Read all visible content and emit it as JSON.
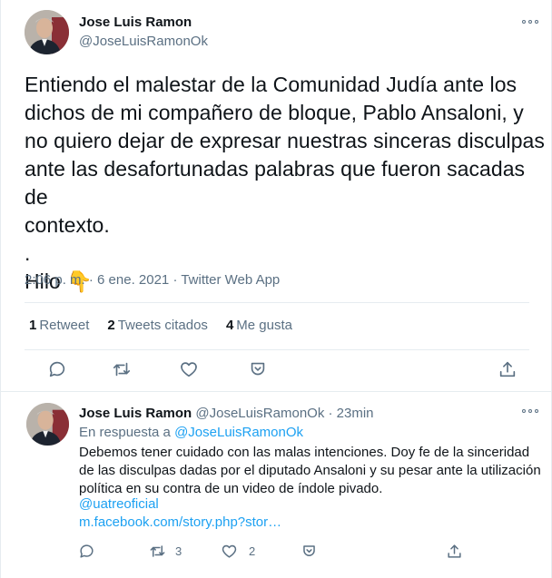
{
  "main_tweet": {
    "author_name": "Jose Luis Ramon",
    "handle": "@JoseLuisRamonOk",
    "text": "Entiendo el malestar de la Comunidad Judía ante los\ndichos de mi compañero de bloque, Pablo Ansaloni, y\nno quiero dejar de expresar nuestras sinceras disculpas\nante las desafortunadas palabras que fueron sacadas de\ncontexto.\n.\nHilo 👇",
    "meta": "2:06 p. m. · 6 ene. 2021 · Twitter Web App",
    "stats": [
      {
        "count": "1",
        "label": "Retweet"
      },
      {
        "count": "2",
        "label": "Tweets citados"
      },
      {
        "count": "4",
        "label": "Me gusta"
      }
    ]
  },
  "reply_tweet": {
    "author_name": "Jose Luis Ramon",
    "handle": "@JoseLuisRamonOk",
    "separator": "·",
    "time": "23min",
    "reply_prefix": "En respuesta a",
    "reply_to": "@JoseLuisRamonOk",
    "text": "Debemos tener cuidado con las malas intenciones. Doy fe de la sinceridad de las disculpas dadas por el diputado Ansaloni y su pesar ante la utilización política en su contra de un video de índole pivado.",
    "mention": "@uatreoficial",
    "url": "m.facebook.com/story.php?stor…",
    "retweet_count": "3",
    "like_count": "2"
  },
  "icons": {
    "more": "more-horizontal-icon",
    "reply": "reply-icon",
    "retweet": "retweet-icon",
    "like": "like-icon",
    "bookmark": "bookmark-icon",
    "share": "share-icon"
  },
  "colors": {
    "text": "#0f1419",
    "secondary": "#5b7083",
    "link": "#1da1f2",
    "border": "#e6ecf0"
  }
}
